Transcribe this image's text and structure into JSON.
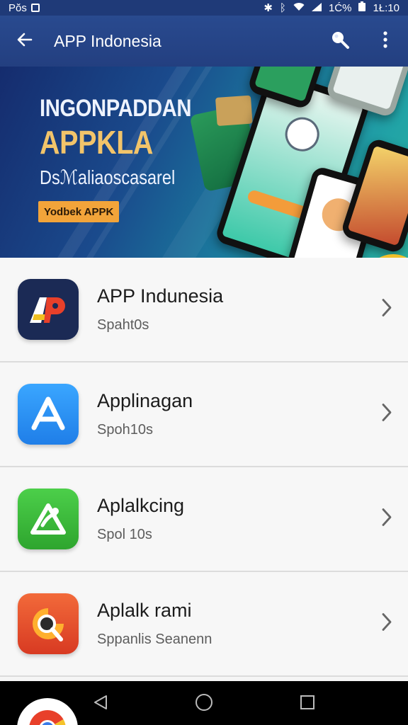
{
  "status_bar": {
    "left_text": "Pŏs",
    "right_percent": "1Ć%",
    "time": "1Ł:10",
    "icons": [
      "image-icon",
      "bluetooth-icon",
      "bluetooth-icon",
      "wifi-icon",
      "signal-icon",
      "battery-icon"
    ]
  },
  "app_bar": {
    "title": "APP Indonesia",
    "back_icon": "arrow-left-icon",
    "search_icon": "search-icon",
    "menu_icon": "more-vertical-icon"
  },
  "banner": {
    "headline_1": "INGONPADDAN",
    "headline_2": "APPKLA",
    "subtitle": "Dsℳaliaoscasarel",
    "cta": "Yodbek APPK",
    "slide_count": 2,
    "active_slide": 1
  },
  "apps": [
    {
      "name": "APP Indunesia",
      "subtitle": "Spaht0s",
      "icon": "ap-logo-icon",
      "color": "#1b2a55"
    },
    {
      "name": "Applinagan",
      "subtitle": "Spoh10s",
      "icon": "app-store-a-icon",
      "color": "#2f8ff2"
    },
    {
      "name": "Aplalkcing",
      "subtitle": "Spol 10s",
      "icon": "triangle-leaf-icon",
      "color": "#3cbc3c"
    },
    {
      "name": "Aplalk rami",
      "subtitle": "Sppanlis Seanenn",
      "icon": "search-lens-icon",
      "color": "#e8502a"
    }
  ],
  "nav_bar": {
    "back": "triangle-back-icon",
    "home": "circle-home-icon",
    "recents": "square-recents-icon",
    "chrome": "chrome-icon"
  },
  "colors": {
    "status_bar": "#1f3a78",
    "app_bar": "#294a8f",
    "banner_accent": "#f2c46a",
    "cta": "#f2a43a"
  }
}
